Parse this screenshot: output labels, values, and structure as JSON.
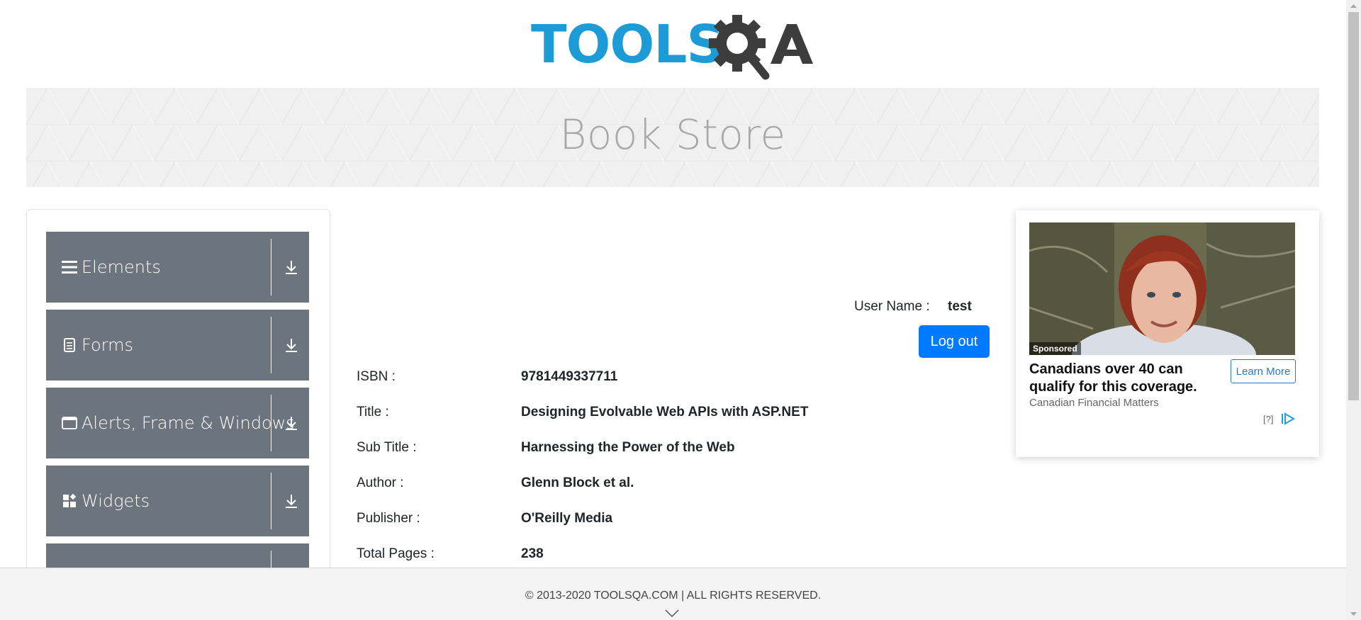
{
  "header": {
    "logo_text": "TOOLSQA",
    "banner_title": "Book Store"
  },
  "sidebar": {
    "groups": [
      {
        "label": "Elements",
        "icon": "hamburger-icon"
      },
      {
        "label": "Forms",
        "icon": "document-icon"
      },
      {
        "label": "Alerts, Frame & Windows",
        "icon": "window-icon"
      },
      {
        "label": "Widgets",
        "icon": "widgets-icon"
      }
    ]
  },
  "user": {
    "name_label": "User Name :",
    "name_value": "test",
    "logout_label": "Log out"
  },
  "book": {
    "rows": [
      {
        "label": "ISBN :",
        "value": "9781449337711"
      },
      {
        "label": "Title :",
        "value": "Designing Evolvable Web APIs with ASP.NET"
      },
      {
        "label": "Sub Title :",
        "value": "Harnessing the Power of the Web"
      },
      {
        "label": "Author :",
        "value": "Glenn Block et al."
      },
      {
        "label": "Publisher :",
        "value": "O'Reilly Media"
      },
      {
        "label": "Total Pages :",
        "value": "238"
      }
    ]
  },
  "ad": {
    "sponsored": "Sponsored",
    "headline": "Canadians over 40 can qualify for this coverage.",
    "cta": "Learn More",
    "source": "Canadian Financial Matters",
    "info": "[?]"
  },
  "footer": {
    "text": "© 2013-2020 TOOLSQA.COM | ALL RIGHTS RESERVED."
  },
  "colors": {
    "brand_blue": "#1d9bd6",
    "brand_dark": "#3d3d3d",
    "nav_gray": "#6c757d",
    "button_blue": "#007bff"
  }
}
